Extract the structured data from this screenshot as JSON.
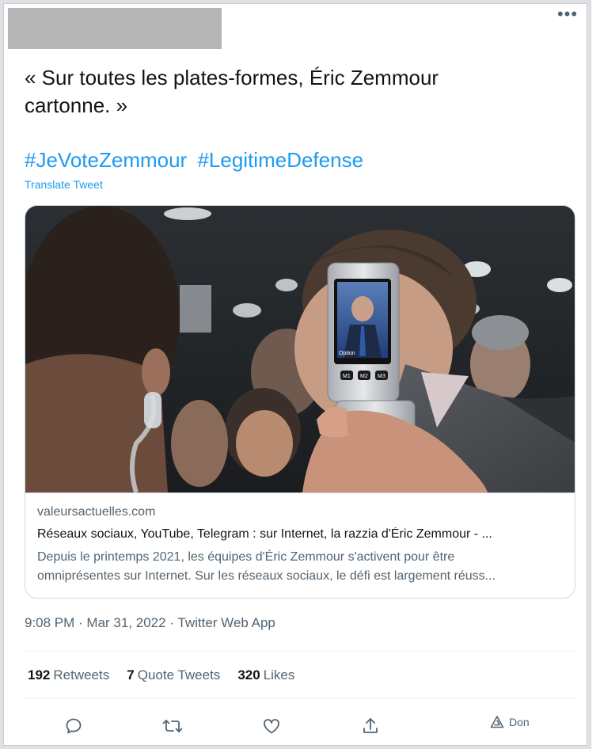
{
  "tweet": {
    "more_icon": "more-horizontal-icon",
    "text_line1": "« Sur toutes les plates-formes, Éric Zemmour",
    "text_line2": "cartonne. »",
    "hashtags": [
      "#JeVoteZemmour",
      "#LegitimeDefense"
    ],
    "translate_label": "Translate Tweet",
    "timestamp": "9:08 PM · Mar 31, 2022 · Twitter Web App"
  },
  "card": {
    "phone_keys": [
      "M1",
      "M2",
      "M3"
    ],
    "phone_digits": [
      "1",
      "2",
      "3"
    ],
    "screen_label": "Option",
    "domain": "valeursactuelles.com",
    "title": "Réseaux sociaux, YouTube, Telegram : sur Internet, la razzia d'Éric Zemmour - ...",
    "desc_line1": "Depuis le printemps 2021, les équipes d'Éric Zemmour s'activent pour être",
    "desc_line2": "omniprésentes sur Internet. Sur les réseaux sociaux, le défi est largement réuss..."
  },
  "stats": {
    "retweets_count": "192",
    "retweets_label": "Retweets",
    "quotes_count": "7",
    "quotes_label": "Quote Tweets",
    "likes_count": "320",
    "likes_label": "Likes"
  },
  "actions": {
    "icons": [
      "reply-icon",
      "retweet-icon",
      "like-icon",
      "share-icon",
      "donate-icon"
    ],
    "don_label": "Don"
  },
  "colors": {
    "link": "#1d9bf0",
    "text": "#0f1419",
    "secondary": "#536471"
  }
}
